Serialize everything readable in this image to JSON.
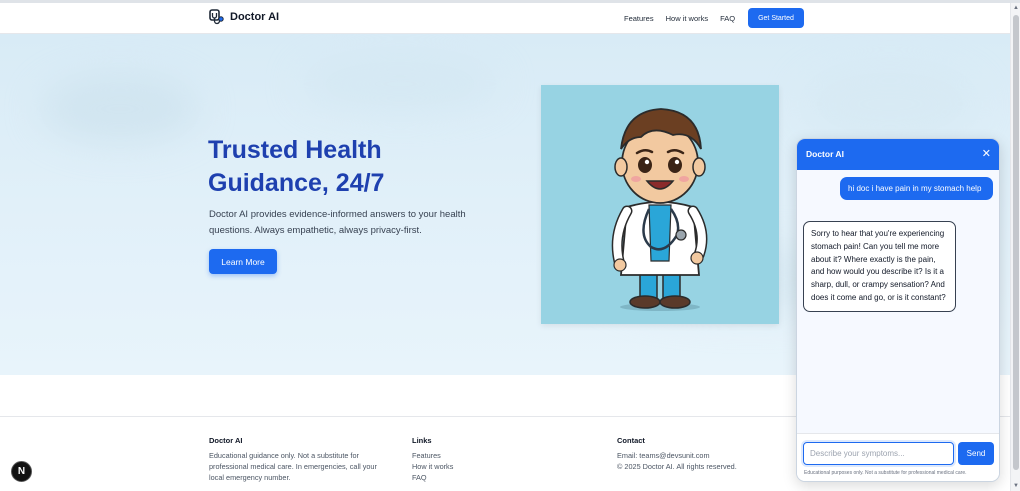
{
  "nav": {
    "brand": "Doctor AI",
    "links": [
      "Features",
      "How it works",
      "FAQ"
    ],
    "cta": "Get Started"
  },
  "hero": {
    "title": "Trusted Health Guidance, 24/7",
    "description": "Doctor AI provides evidence-informed answers to your health questions. Always empathetic, always privacy-first.",
    "button": "Learn More"
  },
  "footer": {
    "about": {
      "heading": "Doctor AI",
      "text": "Educational guidance only. Not a substitute for professional medical care. In emergencies, call your local emergency number."
    },
    "links": {
      "heading": "Links",
      "items": [
        "Features",
        "How it works",
        "FAQ"
      ]
    },
    "contact": {
      "heading": "Contact",
      "email": "Email: teams@devsunit.com",
      "copyright": "© 2025 Doctor AI. All rights reserved."
    }
  },
  "chat": {
    "title": "Doctor AI",
    "close_icon": "close-icon",
    "messages": [
      {
        "role": "user",
        "text": "hi doc i have pain in my stomach help"
      },
      {
        "role": "assistant",
        "text": "Sorry to hear that you're experiencing stomach pain! Can you tell me more about it? Where exactly is the pain, and how would you describe it? Is it a sharp, dull, or crampy sensation? And does it come and go, or is it constant?"
      }
    ],
    "input_placeholder": "Describe your symptoms...",
    "send_label": "Send",
    "disclaimer": "Educational purposes only. Not a substitute for professional medical care."
  },
  "badge": "N",
  "colors": {
    "accent": "#1d6af0",
    "hero_title": "#1e40af",
    "hero_bg": "#dceef8",
    "image_bg": "#97d3e3"
  }
}
